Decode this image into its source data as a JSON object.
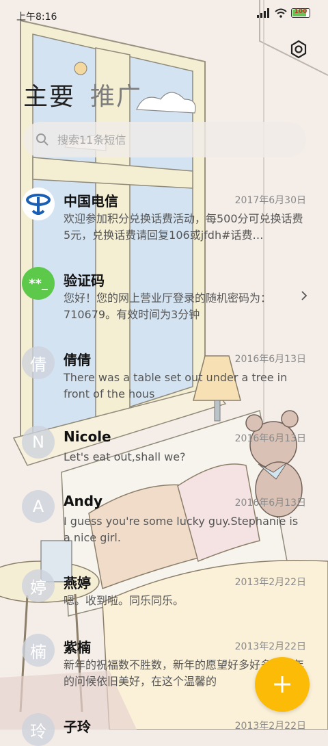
{
  "status": {
    "time": "上午8:16",
    "battery": "100"
  },
  "tabs": [
    {
      "label": "主要"
    },
    {
      "label": "推广"
    }
  ],
  "search": {
    "placeholder": "搜索11条短信"
  },
  "messages": [
    {
      "sender": "中国电信",
      "date": "2017年6月30日",
      "preview": "欢迎参加积分兑换话费活动，每500分可兑换话费5元，兑换话费请回复106或jfdh#话费…",
      "avatar": "china-telecom-logo-icon"
    },
    {
      "sender": "验证码",
      "date": "",
      "preview": "您好！您的网上营业厅登录的随机密码为：710679。有效时间为3分钟",
      "avatar": "**_"
    },
    {
      "sender": "倩倩",
      "date": "2016年6月13日",
      "preview": "There was a table set out under a tree in front of the hous",
      "avatar": "倩"
    },
    {
      "sender": "Nicole",
      "date": "2016年6月13日",
      "preview": "Let's eat out,shall we?",
      "avatar": "N"
    },
    {
      "sender": "Andy",
      "date": "2016年6月13日",
      "preview": "I guess you're some lucky guy.Stephanie is a nice girl.",
      "avatar": "A"
    },
    {
      "sender": "燕婷",
      "date": "2013年2月22日",
      "preview": "嗯。收到啦。同乐同乐。",
      "avatar": "婷"
    },
    {
      "sender": "紫楠",
      "date": "2013年2月22日",
      "preview": "新年的祝福数不胜数，新年的愿望好多好多，新年的问候依旧美好，在这个温馨的",
      "avatar": "楠"
    },
    {
      "sender": "子玲",
      "date": "2013年2月22日",
      "preview": "",
      "avatar": "玲"
    }
  ],
  "colors": {
    "accent_fab": "#fbbb06",
    "verify_avatar": "#5cc94a",
    "telecom_blue": "#1a5fb4"
  }
}
